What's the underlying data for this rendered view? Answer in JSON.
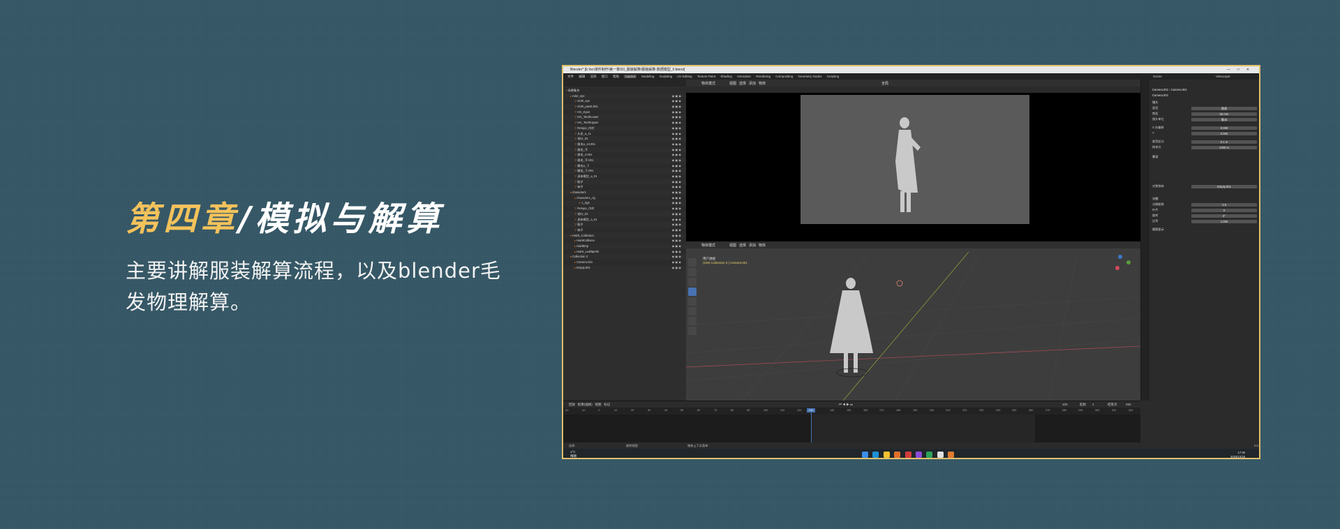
{
  "headline": {
    "accent": "第四章",
    "rest": "/模拟与解算"
  },
  "subtitle": "主要讲解服装解算流程，以及blender毛发物理解算。",
  "blender": {
    "title": "Blender* [E:\\bc\\课件制作\\第一章\\03_服装解算\\服装解算-数据模型_F.blend]",
    "window_controls": [
      "—",
      "□",
      "✕"
    ],
    "menus": [
      "文件",
      "编辑",
      "渲染",
      "窗口",
      "帮助"
    ],
    "workspaces": [
      "Layout",
      "Modeling",
      "Sculpting",
      "UV Editing",
      "Texture Paint",
      "Shading",
      "Animation",
      "Rendering",
      "Compositing",
      "Geometry Nodes",
      "Scripting"
    ],
    "scene": "Scene",
    "view_layer": "ViewLayer",
    "outliner_items": [
      "场景集合",
      "ruler_eye",
      "cloth_eye",
      "cloth_pants.001",
      "HG_Eyes",
      "HG_TeethLower",
      "HG_TeethUpper",
      "Retopo_内衬",
      "头发_a_11",
      "毛叶_01",
      "眉毛a_13.001",
      "眉毛_干",
      "眉毛_2.001",
      "眉毛_干.001",
      "睫毛a_下",
      "睫毛_下.001",
      "身体模型_a_01",
      "鞋子",
      "袜子",
      "character1",
      "character1_rig",
      "c_rigs",
      "Retopo_内衬",
      "毛叶_01",
      "身体模型_a_01",
      "鞋子",
      "袜子",
      "Hair8_Collection",
      "Hair8Collision",
      "Hair8tmp",
      "Hair8_Leaf8prefs",
      "Collection 3",
      "Camera.001",
      "Empty.001"
    ],
    "viewport": {
      "top_mode": "物体模式",
      "top_menus": [
        "视图",
        "选择",
        "添加",
        "物体"
      ],
      "bottom_mode": "物体模式",
      "bottom_menus": [
        "视图",
        "选择",
        "添加",
        "物体"
      ],
      "info_line1": "用户透视",
      "info_line2": "(100) Collection 3 | Camera.001",
      "shading_label": "全局"
    },
    "properties": {
      "breadcrumb": "Camera.001 › Camera.001",
      "object_name": "Camera.001",
      "rows": [
        {
          "label": "镜头",
          "value": "",
          "section": true
        },
        {
          "label": "类型",
          "value": "透视"
        },
        {
          "label": "焦距",
          "value": "50 mm"
        },
        {
          "label": "镜头单位",
          "value": "毫米"
        },
        {
          "label": "X 向偏移",
          "value": "0.000"
        },
        {
          "label": "Y",
          "value": "0.000"
        },
        {
          "label": "裁剪起点",
          "value": "0.1 m"
        },
        {
          "label": "结束点",
          "value": "1000 m"
        },
        {
          "label": "景深",
          "value": "",
          "section": true
        },
        {
          "label": "对焦物体",
          "value": "Empty.001"
        },
        {
          "label": "光圈",
          "value": "",
          "section": true
        },
        {
          "label": "光圈级数",
          "value": "2.8"
        },
        {
          "label": "叶片",
          "value": "0"
        },
        {
          "label": "旋转",
          "value": "0°"
        },
        {
          "label": "比率",
          "value": "1.000"
        },
        {
          "label": "视图显示",
          "value": "",
          "section": true
        }
      ]
    },
    "timeline": {
      "menus": [
        "回放",
        "抠像(插帧)",
        "视图",
        "标记"
      ],
      "current_frame": "100",
      "start_label": "起始",
      "start": "1",
      "end_label": "结束点",
      "end": "250",
      "ruler": [
        "-20",
        "-10",
        "0",
        "10",
        "20",
        "30",
        "40",
        "50",
        "60",
        "70",
        "80",
        "90",
        "100",
        "110",
        "120",
        "130",
        "140",
        "150",
        "160",
        "170",
        "180",
        "190",
        "200",
        "210",
        "220",
        "230",
        "240",
        "250",
        "260",
        "270",
        "280",
        "290",
        "300",
        "310",
        "320"
      ]
    },
    "status": [
      "选择",
      "旋转视图",
      "物体上下文菜单"
    ],
    "version": "3.3.0"
  },
  "taskbar": {
    "weather_temp": "1°C",
    "weather_desc": "晴朗",
    "time": "17:30",
    "date": "2023/12/18",
    "icon_colors": [
      "#3b8ee8",
      "#1e90d6",
      "#f2c12e",
      "#e06f2c",
      "#d23b3b",
      "#8a4bd6",
      "#2ca35a",
      "#e0e0e0",
      "#e07a2f"
    ]
  },
  "colors": {
    "accent": "#f3c25b",
    "background": "#355766",
    "frame": "#e0c06a",
    "blender_blue": "#4772b3"
  }
}
